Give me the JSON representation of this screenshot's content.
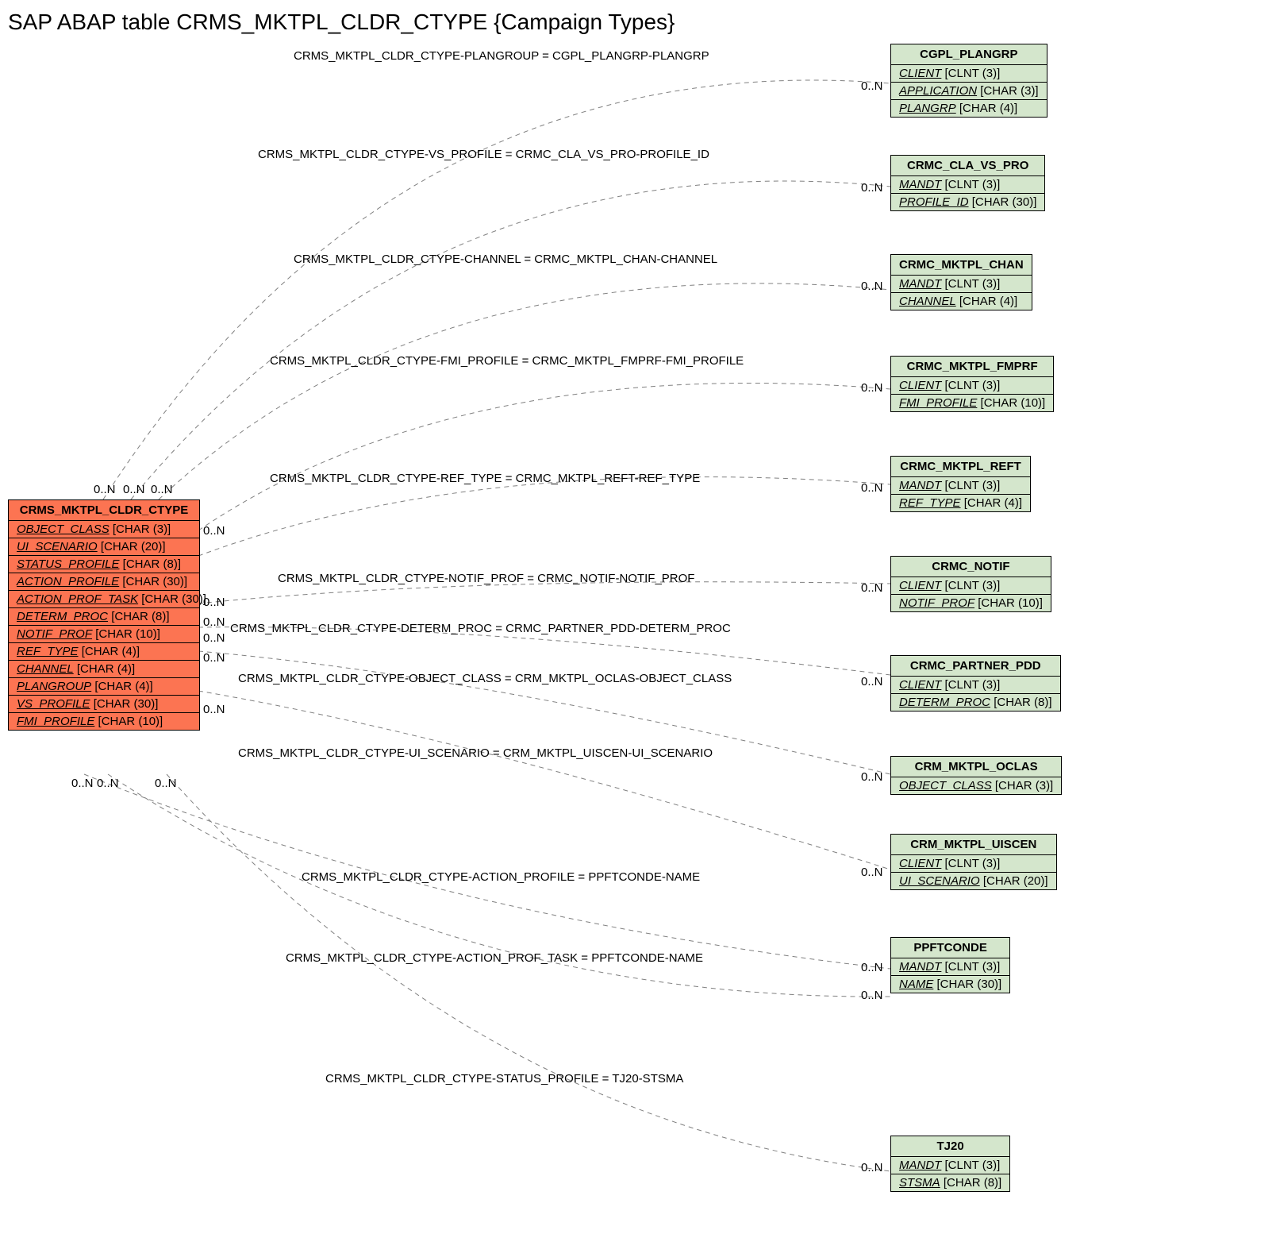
{
  "title": "SAP ABAP table CRMS_MKTPL_CLDR_CTYPE {Campaign Types}",
  "source_table": {
    "name": "CRMS_MKTPL_CLDR_CTYPE",
    "fields": [
      {
        "f": "OBJECT_CLASS",
        "t": "[CHAR (3)]"
      },
      {
        "f": "UI_SCENARIO",
        "t": "[CHAR (20)]"
      },
      {
        "f": "STATUS_PROFILE",
        "t": "[CHAR (8)]"
      },
      {
        "f": "ACTION_PROFILE",
        "t": "[CHAR (30)]"
      },
      {
        "f": "ACTION_PROF_TASK",
        "t": "[CHAR (30)]"
      },
      {
        "f": "DETERM_PROC",
        "t": "[CHAR (8)]"
      },
      {
        "f": "NOTIF_PROF",
        "t": "[CHAR (10)]"
      },
      {
        "f": "REF_TYPE",
        "t": "[CHAR (4)]"
      },
      {
        "f": "CHANNEL",
        "t": "[CHAR (4)]"
      },
      {
        "f": "PLANGROUP",
        "t": "[CHAR (4)]"
      },
      {
        "f": "VS_PROFILE",
        "t": "[CHAR (30)]"
      },
      {
        "f": "FMI_PROFILE",
        "t": "[CHAR (10)]"
      }
    ]
  },
  "rel_labels": {
    "r0": "CRMS_MKTPL_CLDR_CTYPE-PLANGROUP = CGPL_PLANGRP-PLANGRP",
    "r1": "CRMS_MKTPL_CLDR_CTYPE-VS_PROFILE = CRMC_CLA_VS_PRO-PROFILE_ID",
    "r2": "CRMS_MKTPL_CLDR_CTYPE-CHANNEL = CRMC_MKTPL_CHAN-CHANNEL",
    "r3": "CRMS_MKTPL_CLDR_CTYPE-FMI_PROFILE = CRMC_MKTPL_FMPRF-FMI_PROFILE",
    "r4": "CRMS_MKTPL_CLDR_CTYPE-REF_TYPE = CRMC_MKTPL_REFT-REF_TYPE",
    "r5": "CRMS_MKTPL_CLDR_CTYPE-NOTIF_PROF = CRMC_NOTIF-NOTIF_PROF",
    "r6": "CRMS_MKTPL_CLDR_CTYPE-DETERM_PROC = CRMC_PARTNER_PDD-DETERM_PROC",
    "r7": "CRMS_MKTPL_CLDR_CTYPE-OBJECT_CLASS = CRM_MKTPL_OCLAS-OBJECT_CLASS",
    "r8": "CRMS_MKTPL_CLDR_CTYPE-UI_SCENARIO = CRM_MKTPL_UISCEN-UI_SCENARIO",
    "r9": "CRMS_MKTPL_CLDR_CTYPE-ACTION_PROFILE = PPFTCONDE-NAME",
    "r10": "CRMS_MKTPL_CLDR_CTYPE-ACTION_PROF_TASK = PPFTCONDE-NAME",
    "r11": "CRMS_MKTPL_CLDR_CTYPE-STATUS_PROFILE = TJ20-STSMA"
  },
  "targets": {
    "t0": {
      "name": "CGPL_PLANGRP",
      "rows": [
        {
          "f": "CLIENT",
          "t": "[CLNT (3)]"
        },
        {
          "f": "APPLICATION",
          "t": "[CHAR (3)]"
        },
        {
          "f": "PLANGRP",
          "t": "[CHAR (4)]"
        }
      ]
    },
    "t1": {
      "name": "CRMC_CLA_VS_PRO",
      "rows": [
        {
          "f": "MANDT",
          "t": "[CLNT (3)]"
        },
        {
          "f": "PROFILE_ID",
          "t": "[CHAR (30)]"
        }
      ]
    },
    "t2": {
      "name": "CRMC_MKTPL_CHAN",
      "rows": [
        {
          "f": "MANDT",
          "t": "[CLNT (3)]"
        },
        {
          "f": "CHANNEL",
          "t": "[CHAR (4)]"
        }
      ]
    },
    "t3": {
      "name": "CRMC_MKTPL_FMPRF",
      "rows": [
        {
          "f": "CLIENT",
          "t": "[CLNT (3)]"
        },
        {
          "f": "FMI_PROFILE",
          "t": "[CHAR (10)]"
        }
      ]
    },
    "t4": {
      "name": "CRMC_MKTPL_REFT",
      "rows": [
        {
          "f": "MANDT",
          "t": "[CLNT (3)]"
        },
        {
          "f": "REF_TYPE",
          "t": "[CHAR (4)]"
        }
      ]
    },
    "t5": {
      "name": "CRMC_NOTIF",
      "rows": [
        {
          "f": "CLIENT",
          "t": "[CLNT (3)]"
        },
        {
          "f": "NOTIF_PROF",
          "t": "[CHAR (10)]"
        }
      ]
    },
    "t6": {
      "name": "CRMC_PARTNER_PDD",
      "rows": [
        {
          "f": "CLIENT",
          "t": "[CLNT (3)]"
        },
        {
          "f": "DETERM_PROC",
          "t": "[CHAR (8)]"
        }
      ]
    },
    "t7": {
      "name": "CRM_MKTPL_OCLAS",
      "rows": [
        {
          "f": "OBJECT_CLASS",
          "t": "[CHAR (3)]"
        }
      ]
    },
    "t8": {
      "name": "CRM_MKTPL_UISCEN",
      "rows": [
        {
          "f": "CLIENT",
          "t": "[CLNT (3)]"
        },
        {
          "f": "UI_SCENARIO",
          "t": "[CHAR (20)]"
        }
      ]
    },
    "t9": {
      "name": "PPFTCONDE",
      "rows": [
        {
          "f": "MANDT",
          "t": "[CLNT (3)]"
        },
        {
          "f": "NAME",
          "t": "[CHAR (30)]"
        }
      ]
    },
    "t10": {
      "name": "TJ20",
      "rows": [
        {
          "f": "MANDT",
          "t": "[CLNT (3)]"
        },
        {
          "f": "STSMA",
          "t": "[CHAR (8)]"
        }
      ]
    }
  },
  "card": "0..N",
  "src_cards": {
    "a": "0..N",
    "b": "0..N",
    "c": "0..N",
    "d": "0..N",
    "e": "0..N",
    "f": "0..N",
    "g": "0..N",
    "h": "0..N",
    "i": "0..N",
    "j": "0..N",
    "k": "0..N"
  }
}
